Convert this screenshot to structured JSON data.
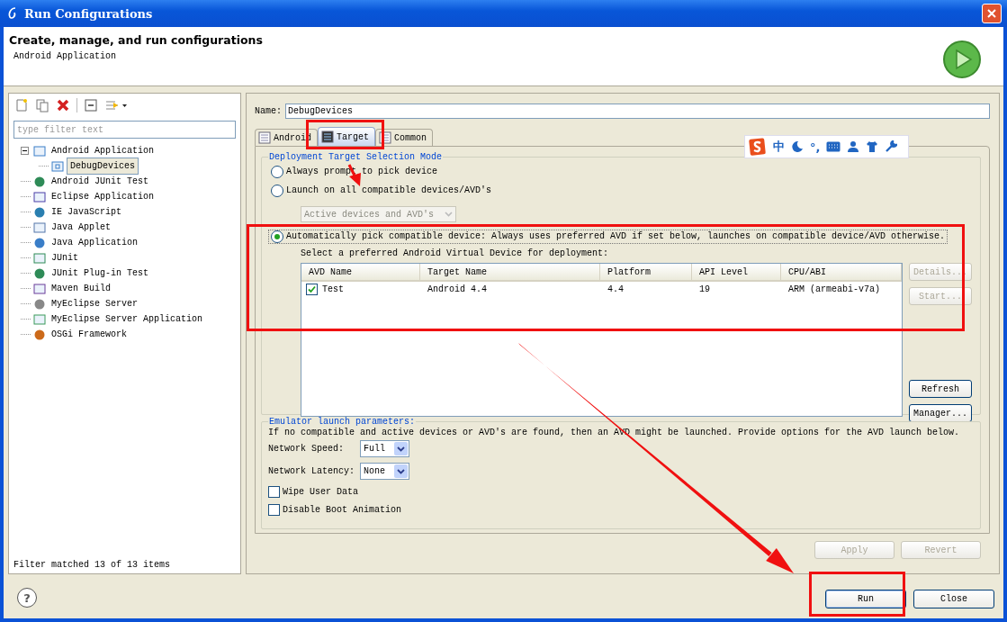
{
  "window": {
    "title": "Run Configurations"
  },
  "header": {
    "title": "Create, manage, and run configurations",
    "subtitle": "Android Application"
  },
  "sidebar": {
    "filter": {
      "placeholder": "type filter text"
    },
    "tree": [
      {
        "label": "Android Application",
        "selected": false,
        "expanded": true,
        "children": [
          {
            "label": "DebugDevices",
            "selected": true
          }
        ]
      },
      {
        "label": "Android JUnit Test",
        "selected": false
      },
      {
        "label": "Eclipse Application",
        "selected": false
      },
      {
        "label": "IE JavaScript",
        "selected": false
      },
      {
        "label": "Java Applet",
        "selected": false
      },
      {
        "label": "Java Application",
        "selected": false
      },
      {
        "label": "JUnit",
        "selected": false
      },
      {
        "label": "JUnit Plug-in Test",
        "selected": false
      },
      {
        "label": "Maven Build",
        "selected": false
      },
      {
        "label": "MyEclipse Server",
        "selected": false
      },
      {
        "label": "MyEclipse Server Application",
        "selected": false
      },
      {
        "label": "OSGi Framework",
        "selected": false
      }
    ],
    "status": "Filter matched 13 of 13 items"
  },
  "name_field": {
    "label": "Name:",
    "value": "DebugDevices"
  },
  "tabs": [
    {
      "label": "Android",
      "selected": false
    },
    {
      "label": "Target",
      "selected": true
    },
    {
      "label": "Common",
      "selected": false
    }
  ],
  "deployment": {
    "title": "Deployment Target Selection Mode",
    "options": [
      {
        "label": "Always prompt to pick device",
        "selected": false
      },
      {
        "label": "Launch on all compatible devices/AVD's",
        "selected": false
      },
      {
        "label": "Automatically pick compatible device: Always uses preferred AVD if set below, launches on compatible device/AVD otherwise.",
        "selected": true
      }
    ],
    "dropdown": {
      "value": "Active devices and AVD's",
      "disabled": true
    },
    "caption": "Select a preferred Android Virtual Device for deployment:",
    "table": {
      "columns": [
        "AVD Name",
        "Target Name",
        "Platform",
        "API Level",
        "CPU/ABI"
      ],
      "rows": [
        {
          "checked": true,
          "cells": [
            "Test",
            "Android 4.4",
            "4.4",
            "19",
            "ARM (armeabi-v7a)"
          ]
        }
      ]
    },
    "buttons": [
      {
        "label": "Details...",
        "disabled": true
      },
      {
        "label": "Start...",
        "disabled": true
      },
      {
        "label": "Refresh",
        "disabled": false
      },
      {
        "label": "Manager...",
        "disabled": false
      }
    ]
  },
  "emulator": {
    "title": "Emulator launch parameters:",
    "note": "If no compatible and active devices or AVD's are found, then an AVD might be launched. Provide options for the AVD launch below.",
    "fields": [
      {
        "label": "Network Speed:",
        "value": "Full"
      },
      {
        "label": "Network Latency:",
        "value": "None"
      }
    ],
    "checkboxes": [
      {
        "label": "Wipe User Data",
        "checked": false
      },
      {
        "label": "Disable Boot Animation",
        "checked": false
      }
    ]
  },
  "actions": [
    {
      "label": "Apply",
      "disabled": true
    },
    {
      "label": "Revert",
      "disabled": true
    }
  ],
  "footer": {
    "help": "?",
    "buttons": [
      {
        "label": "Run",
        "default": true
      },
      {
        "label": "Close",
        "default": false
      }
    ]
  },
  "ime_toolbar": {
    "items": [
      "中",
      "°,"
    ]
  }
}
